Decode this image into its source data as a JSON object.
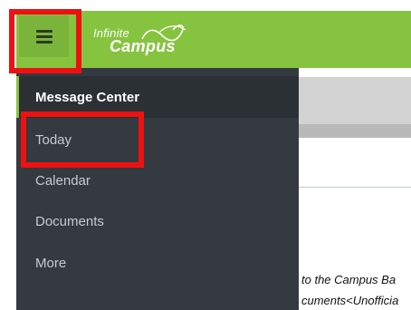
{
  "header": {
    "logo_top": "Infinite",
    "logo_bottom": "Campus",
    "menu_icon": "hamburger-menu-icon",
    "brand_color": "#86c440"
  },
  "nav": {
    "items": [
      {
        "label": "Message Center",
        "active": true
      },
      {
        "label": "Today",
        "active": false
      },
      {
        "label": "Calendar",
        "active": false
      },
      {
        "label": "Documents",
        "active": false
      },
      {
        "label": "More",
        "active": false
      }
    ]
  },
  "content": {
    "line1": "to the Campus Ba",
    "line2": "cuments<Unofficia"
  },
  "annotation_color": "#ee1111"
}
